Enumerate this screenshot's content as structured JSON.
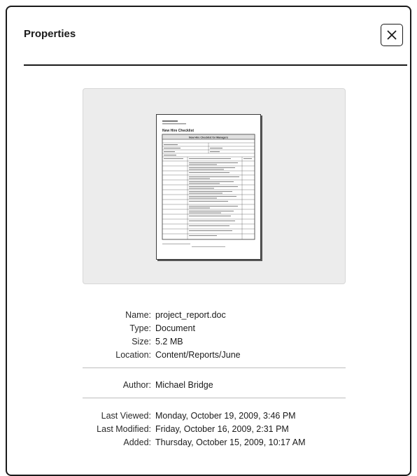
{
  "dialog": {
    "title": "Properties",
    "close_icon": "close-x-icon"
  },
  "preview": {
    "thumbnail_title": "New Hire Checklist",
    "thumbnail_table_title": "New Hire Checklist for Managers"
  },
  "properties": {
    "name": {
      "label": "Name:",
      "value": "project_report.doc"
    },
    "type": {
      "label": "Type:",
      "value": "Document"
    },
    "size": {
      "label": "Size:",
      "value": "5.2 MB"
    },
    "location": {
      "label": "Location:",
      "value": "Content/Reports/June"
    },
    "author": {
      "label": "Author:",
      "value": "Michael Bridge"
    },
    "last_viewed": {
      "label": "Last Viewed:",
      "value": "Monday, October 19, 2009, 3:46 PM"
    },
    "last_modified": {
      "label": "Last Modified:",
      "value": "Friday, October 16, 2009, 2:31 PM"
    },
    "added": {
      "label": "Added:",
      "value": "Thursday, October 15, 2009, 10:17 AM"
    }
  },
  "colors": {
    "text": "#1a1a1a",
    "preview_bg": "#ececec",
    "separator": "#bdbdbd"
  }
}
